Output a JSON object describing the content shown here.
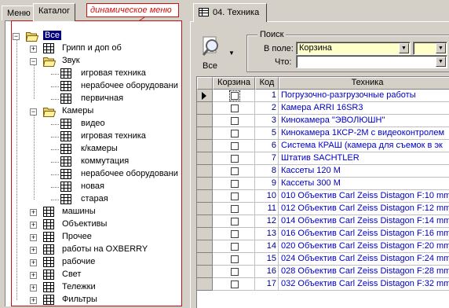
{
  "left_tabs": [
    {
      "label": "Меню",
      "active": false
    },
    {
      "label": "Каталог",
      "active": true
    }
  ],
  "annotation": "динамическое меню",
  "tree": [
    {
      "label": "Все",
      "level": 0,
      "type": "folder-open",
      "toggle": "-",
      "selected": true
    },
    {
      "label": "Грипп и доп об",
      "level": 1,
      "type": "table",
      "toggle": "+"
    },
    {
      "label": "Звук",
      "level": 1,
      "type": "folder-open",
      "toggle": "-"
    },
    {
      "label": "игровая техника",
      "level": 2,
      "type": "table",
      "toggle": ""
    },
    {
      "label": "нерабочее оборудовани",
      "level": 2,
      "type": "table",
      "toggle": ""
    },
    {
      "label": "первичная",
      "level": 2,
      "type": "table",
      "toggle": ""
    },
    {
      "label": "Камеры",
      "level": 1,
      "type": "folder-open",
      "toggle": "-"
    },
    {
      "label": "видео",
      "level": 2,
      "type": "table",
      "toggle": ""
    },
    {
      "label": "игровая техника",
      "level": 2,
      "type": "table",
      "toggle": ""
    },
    {
      "label": "к/камеры",
      "level": 2,
      "type": "table",
      "toggle": ""
    },
    {
      "label": "коммутация",
      "level": 2,
      "type": "table",
      "toggle": ""
    },
    {
      "label": "нерабочее оборудовани",
      "level": 2,
      "type": "table",
      "toggle": ""
    },
    {
      "label": "новая",
      "level": 2,
      "type": "table",
      "toggle": ""
    },
    {
      "label": "старая",
      "level": 2,
      "type": "table",
      "toggle": ""
    },
    {
      "label": "машины",
      "level": 1,
      "type": "table",
      "toggle": "+"
    },
    {
      "label": "Объективы",
      "level": 1,
      "type": "table",
      "toggle": "+"
    },
    {
      "label": "Прочее",
      "level": 1,
      "type": "table",
      "toggle": "+"
    },
    {
      "label": "работы на OXBERRY",
      "level": 1,
      "type": "table",
      "toggle": "+"
    },
    {
      "label": "рабочие",
      "level": 1,
      "type": "table",
      "toggle": "+"
    },
    {
      "label": "Свет",
      "level": 1,
      "type": "table",
      "toggle": "+"
    },
    {
      "label": "Тележки",
      "level": 1,
      "type": "table",
      "toggle": "+"
    },
    {
      "label": "Фильтры",
      "level": 1,
      "type": "table",
      "toggle": "+"
    }
  ],
  "right_tab": {
    "label": "04. Техника"
  },
  "toolbar": {
    "all_label": "Все"
  },
  "search": {
    "title": "Поиск",
    "field_label": "В поле:",
    "field_value": "Корзина",
    "what_label": "Что:",
    "what_value": ""
  },
  "grid": {
    "columns": [
      "Корзина",
      "Код",
      "Техника"
    ],
    "rows": [
      {
        "kod": "1",
        "tech": "Погрузочно-разгрузочные работы",
        "current": true
      },
      {
        "kod": "2",
        "tech": "Камера  ARRI 16SR3"
      },
      {
        "kod": "3",
        "tech": "Кинокамера \"ЭВОЛЮШН\""
      },
      {
        "kod": "5",
        "tech": "Кинокамера 1КСР-2М с видеоконтролем"
      },
      {
        "kod": "6",
        "tech": "Система КРАШ (камера для съемок в эк"
      },
      {
        "kod": "7",
        "tech": "Штатив SACHTLER"
      },
      {
        "kod": "8",
        "tech": "Кассеты 120 М"
      },
      {
        "kod": "9",
        "tech": "Кассеты 300 М"
      },
      {
        "kod": "10",
        "tech": "010 Объектив Carl Zeiss Distagon F:10 mm"
      },
      {
        "kod": "11",
        "tech": "012 Объектив Carl Zeiss Distagon F:12 mm"
      },
      {
        "kod": "12",
        "tech": "014 Объектив Carl Zeiss Distagon F:14 mm"
      },
      {
        "kod": "13",
        "tech": "016 Объектив Carl Zeiss Distagon F:16 mm"
      },
      {
        "kod": "14",
        "tech": "020 Объектив Carl Zeiss Distagon F:20 mm"
      },
      {
        "kod": "15",
        "tech": "024 Объектив Carl Zeiss Distagon F:24 mm"
      },
      {
        "kod": "16",
        "tech": "028 Объектив Carl Zeiss Distagon F:28 mm"
      },
      {
        "kod": "17",
        "tech": "032 Объектив Carl Zeiss Distagon F:32 mm"
      }
    ]
  },
  "colors": {
    "selection": "#000080",
    "annotation": "#d01010",
    "link_text": "#0000c0",
    "highlight_field": "#ffffc8"
  }
}
